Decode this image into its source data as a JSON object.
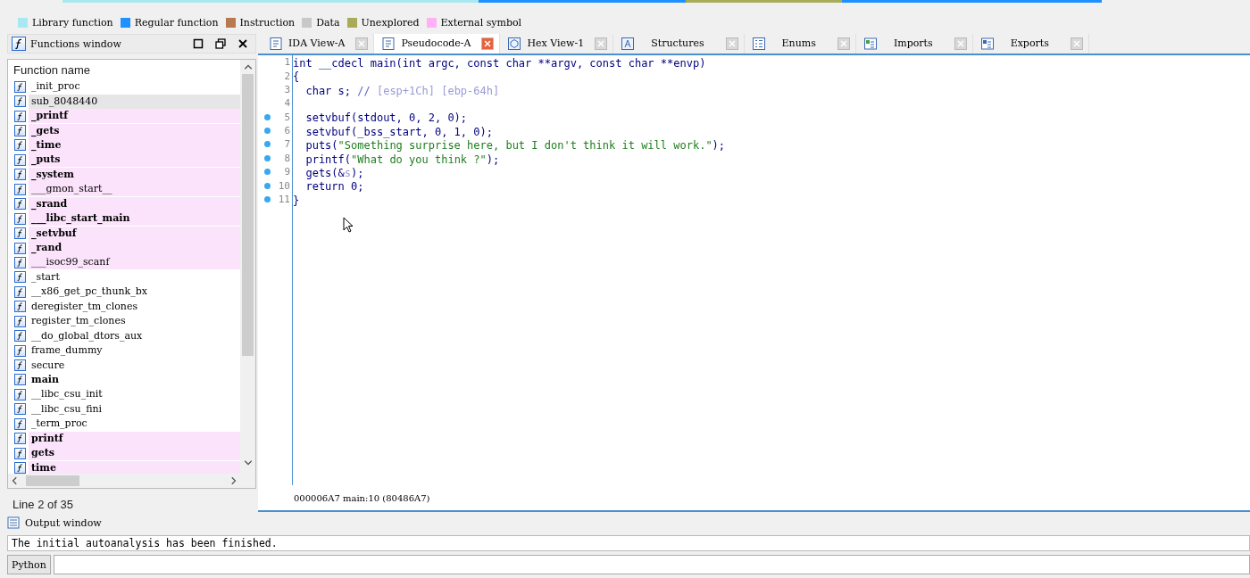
{
  "legend": [
    {
      "label": "Library function",
      "color": "#a8e8f0"
    },
    {
      "label": "Regular function",
      "color": "#1e90ff"
    },
    {
      "label": "Instruction",
      "color": "#b87850"
    },
    {
      "label": "Data",
      "color": "#c8c8c8"
    },
    {
      "label": "Unexplored",
      "color": "#a8ac58"
    },
    {
      "label": "External symbol",
      "color": "#ffb0f8"
    }
  ],
  "functions_window": {
    "title": "Functions window",
    "column": "Function name",
    "status": "Line 2 of 35",
    "items": [
      {
        "name": "_init_proc",
        "bold": false,
        "external": false,
        "selected": false
      },
      {
        "name": "sub_8048440",
        "bold": false,
        "external": false,
        "selected": true
      },
      {
        "name": "_printf",
        "bold": true,
        "external": true,
        "selected": false
      },
      {
        "name": "_gets",
        "bold": true,
        "external": true,
        "selected": false
      },
      {
        "name": "_time",
        "bold": true,
        "external": true,
        "selected": false
      },
      {
        "name": "_puts",
        "bold": true,
        "external": true,
        "selected": false
      },
      {
        "name": "_system",
        "bold": true,
        "external": true,
        "selected": false
      },
      {
        "name": "___gmon_start__",
        "bold": false,
        "external": true,
        "selected": false
      },
      {
        "name": "_srand",
        "bold": true,
        "external": true,
        "selected": false
      },
      {
        "name": "___libc_start_main",
        "bold": true,
        "external": true,
        "selected": false
      },
      {
        "name": "_setvbuf",
        "bold": true,
        "external": true,
        "selected": false
      },
      {
        "name": "_rand",
        "bold": true,
        "external": true,
        "selected": false
      },
      {
        "name": "___isoc99_scanf",
        "bold": false,
        "external": true,
        "selected": false
      },
      {
        "name": "_start",
        "bold": false,
        "external": false,
        "selected": false
      },
      {
        "name": "__x86_get_pc_thunk_bx",
        "bold": false,
        "external": false,
        "selected": false
      },
      {
        "name": "deregister_tm_clones",
        "bold": false,
        "external": false,
        "selected": false
      },
      {
        "name": "register_tm_clones",
        "bold": false,
        "external": false,
        "selected": false
      },
      {
        "name": "__do_global_dtors_aux",
        "bold": false,
        "external": false,
        "selected": false
      },
      {
        "name": "frame_dummy",
        "bold": false,
        "external": false,
        "selected": false
      },
      {
        "name": "secure",
        "bold": false,
        "external": false,
        "selected": false
      },
      {
        "name": "main",
        "bold": true,
        "external": false,
        "selected": false
      },
      {
        "name": "__libc_csu_init",
        "bold": false,
        "external": false,
        "selected": false
      },
      {
        "name": "__libc_csu_fini",
        "bold": false,
        "external": false,
        "selected": false
      },
      {
        "name": "_term_proc",
        "bold": false,
        "external": false,
        "selected": false
      },
      {
        "name": "printf",
        "bold": true,
        "external": true,
        "selected": false
      },
      {
        "name": "gets",
        "bold": true,
        "external": true,
        "selected": false
      },
      {
        "name": "time",
        "bold": true,
        "external": true,
        "selected": false
      }
    ]
  },
  "tabs": [
    {
      "label": "IDA View-A",
      "kind": "disasm",
      "selected": false
    },
    {
      "label": "Pseudocode-A",
      "kind": "pseudo",
      "selected": true
    },
    {
      "label": "Hex View-1",
      "kind": "hex",
      "selected": false
    },
    {
      "label": "Structures",
      "kind": "struct",
      "selected": false
    },
    {
      "label": "Enums",
      "kind": "enum",
      "selected": false
    },
    {
      "label": "Imports",
      "kind": "imports",
      "selected": false
    },
    {
      "label": "Exports",
      "kind": "exports",
      "selected": false
    }
  ],
  "code": [
    {
      "number": "1",
      "breakpoint": false,
      "segments": [
        {
          "text": "int __cdecl main(int argc, const char **argv, const char **envp)",
          "kind": "code"
        }
      ]
    },
    {
      "number": "2",
      "breakpoint": false,
      "segments": [
        {
          "text": "{",
          "kind": "code"
        }
      ]
    },
    {
      "number": "3",
      "breakpoint": false,
      "segments": [
        {
          "text": "  char s; ",
          "kind": "code"
        },
        {
          "text": "// ",
          "kind": "comment"
        },
        {
          "text": "[esp+1Ch] [ebp-64h]",
          "kind": "hint"
        }
      ]
    },
    {
      "number": "4",
      "breakpoint": false
    },
    {
      "number": "5",
      "breakpoint": true,
      "segments": [
        {
          "text": "  setvbuf(stdout, 0, 2, 0);",
          "kind": "code"
        }
      ]
    },
    {
      "number": "6",
      "breakpoint": true,
      "segments": [
        {
          "text": "  setvbuf(_bss_start, 0, 1, 0);",
          "kind": "code"
        }
      ]
    },
    {
      "number": "7",
      "breakpoint": true,
      "segments": [
        {
          "text": "  puts(",
          "kind": "code"
        },
        {
          "text": "\"Something surprise here, but I don't think it will work.\"",
          "kind": "string"
        },
        {
          "text": ");",
          "kind": "code"
        }
      ]
    },
    {
      "number": "8",
      "breakpoint": true,
      "segments": [
        {
          "text": "  printf(",
          "kind": "code"
        },
        {
          "text": "\"What do you think ?\"",
          "kind": "string"
        },
        {
          "text": ");",
          "kind": "code"
        }
      ]
    },
    {
      "number": "9",
      "breakpoint": true,
      "segments": [
        {
          "text": "  gets(&",
          "kind": "code"
        },
        {
          "text": "s",
          "kind": "hint"
        },
        {
          "text": ");",
          "kind": "code"
        }
      ]
    },
    {
      "number": "10",
      "breakpoint": true,
      "segments": [
        {
          "text": "  return 0;",
          "kind": "code"
        }
      ]
    },
    {
      "number": "11",
      "breakpoint": true,
      "segments": [
        {
          "text": "}",
          "kind": "code"
        }
      ]
    }
  ],
  "code_status": "000006A7 main:10 (80486A7)",
  "output_window": {
    "title": "Output window",
    "message": "The initial autoanalysis has been finished.",
    "language": "Python"
  }
}
